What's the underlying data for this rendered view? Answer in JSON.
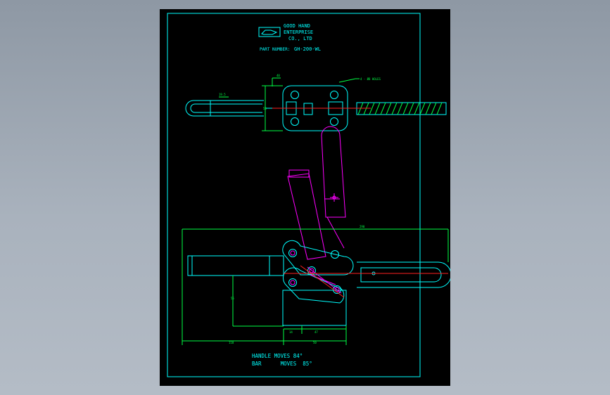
{
  "title_block": {
    "company_line1": "GOOD HAND",
    "company_line2": "ENTERPRISE",
    "company_line3": "CO., LTD",
    "part_number_label": "PART NUMBER:",
    "part_number_value": "GH-200-WL"
  },
  "annotations": {
    "hole_callout": "4 - Ø8 HOLES"
  },
  "dimensions": {
    "top_width": "40",
    "top_height": "50",
    "handle_offset": "19.5",
    "overall_length": "290",
    "vertical_height": "55",
    "small_offset": "14",
    "mid_offset": "47",
    "left_length": "110",
    "right_length": "50"
  },
  "notes": {
    "handle_note": "HANDLE MOVES 84°",
    "bar_note": "BAR      MOVES  85°"
  },
  "colors": {
    "background": "#000000",
    "outline": "#00ffff",
    "moved_position": "#ff00ff",
    "dimension": "#00ff44",
    "centerline": "#ff2020"
  }
}
